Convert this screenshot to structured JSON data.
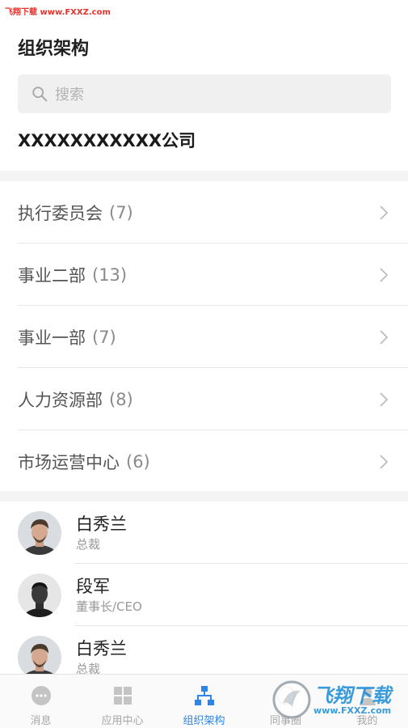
{
  "watermark_top": "飞翔下载 www.FXXZ.com",
  "header": {
    "title": "组织架构"
  },
  "search": {
    "placeholder": "搜索",
    "icon": "search-icon"
  },
  "company": {
    "name": "XXXXXXXXXXX公司"
  },
  "departments": [
    {
      "name": "执行委员会",
      "count": "(7)"
    },
    {
      "name": "事业二部",
      "count": "(13)"
    },
    {
      "name": "事业一部",
      "count": "(7)"
    },
    {
      "name": "人力资源部",
      "count": "(8)"
    },
    {
      "name": "市场运营中心",
      "count": "(6)"
    }
  ],
  "members": [
    {
      "name": "白秀兰",
      "title": "总裁"
    },
    {
      "name": "段军",
      "title": "董事长/CEO"
    },
    {
      "name": "白秀兰",
      "title": "总裁"
    }
  ],
  "tabbar": {
    "active_color": "#2d86e5",
    "inactive_color": "#a6a6a6",
    "tabs": [
      {
        "label": "消息",
        "icon": "chat-bubble-icon"
      },
      {
        "label": "应用中心",
        "icon": "grid-apps-icon"
      },
      {
        "label": "组织架构",
        "icon": "org-chart-icon",
        "active": true
      },
      {
        "label": "同事圈",
        "icon": "circle-icon"
      },
      {
        "label": "我的",
        "icon": "person-icon"
      }
    ]
  },
  "watermark_logo": {
    "text": "飞翔下载",
    "url": "www.FXXZ.com"
  }
}
